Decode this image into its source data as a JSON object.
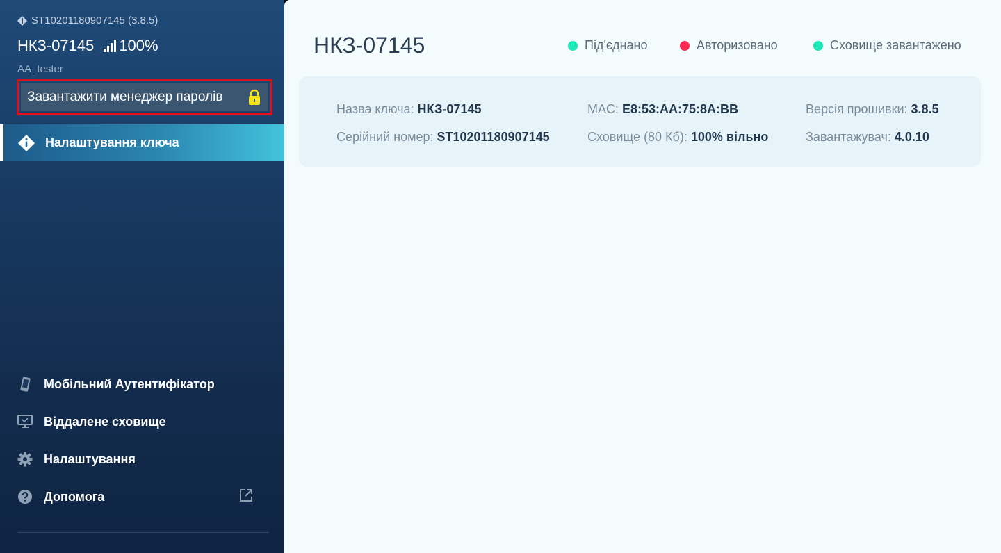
{
  "sidebar": {
    "serial_line": "ST10201180907145 (3.8.5)",
    "device_name": "НКЗ-07145",
    "battery": "100%",
    "user": "AA_tester",
    "load_button_label": "Завантажити менеджер паролів",
    "active_item_label": "Налаштування ключа",
    "bottom_items": [
      {
        "label": "Мобільний Аутентифікатор",
        "icon": "phone-icon"
      },
      {
        "label": "Віддалене сховище",
        "icon": "monitor-icon"
      },
      {
        "label": "Налаштування",
        "icon": "gear-icon"
      },
      {
        "label": "Допомога",
        "icon": "help-icon"
      }
    ]
  },
  "main": {
    "title": "НКЗ-07145",
    "statuses": [
      {
        "label": "Під'єднано",
        "color": "#1de9b6"
      },
      {
        "label": "Авторизовано",
        "color": "#ff2d55"
      },
      {
        "label": "Сховище завантажено",
        "color": "#1de9b6"
      }
    ],
    "info": {
      "key_name_label": "Назва ключа:",
      "key_name_value": "НКЗ-07145",
      "serial_label": "Серійний номер:",
      "serial_value": "ST10201180907145",
      "mac_label": "MAC:",
      "mac_value": "E8:53:AA:75:8A:BB",
      "storage_label": "Сховище (80 Кб):",
      "storage_value": "100% вільно",
      "firmware_label": "Версія прошивки:",
      "firmware_value": "3.8.5",
      "bootloader_label": "Завантажувач:",
      "bootloader_value": "4.0.10"
    }
  },
  "colors": {
    "accent_red": "#e0101b",
    "lock_yellow": "#f5e31a"
  }
}
